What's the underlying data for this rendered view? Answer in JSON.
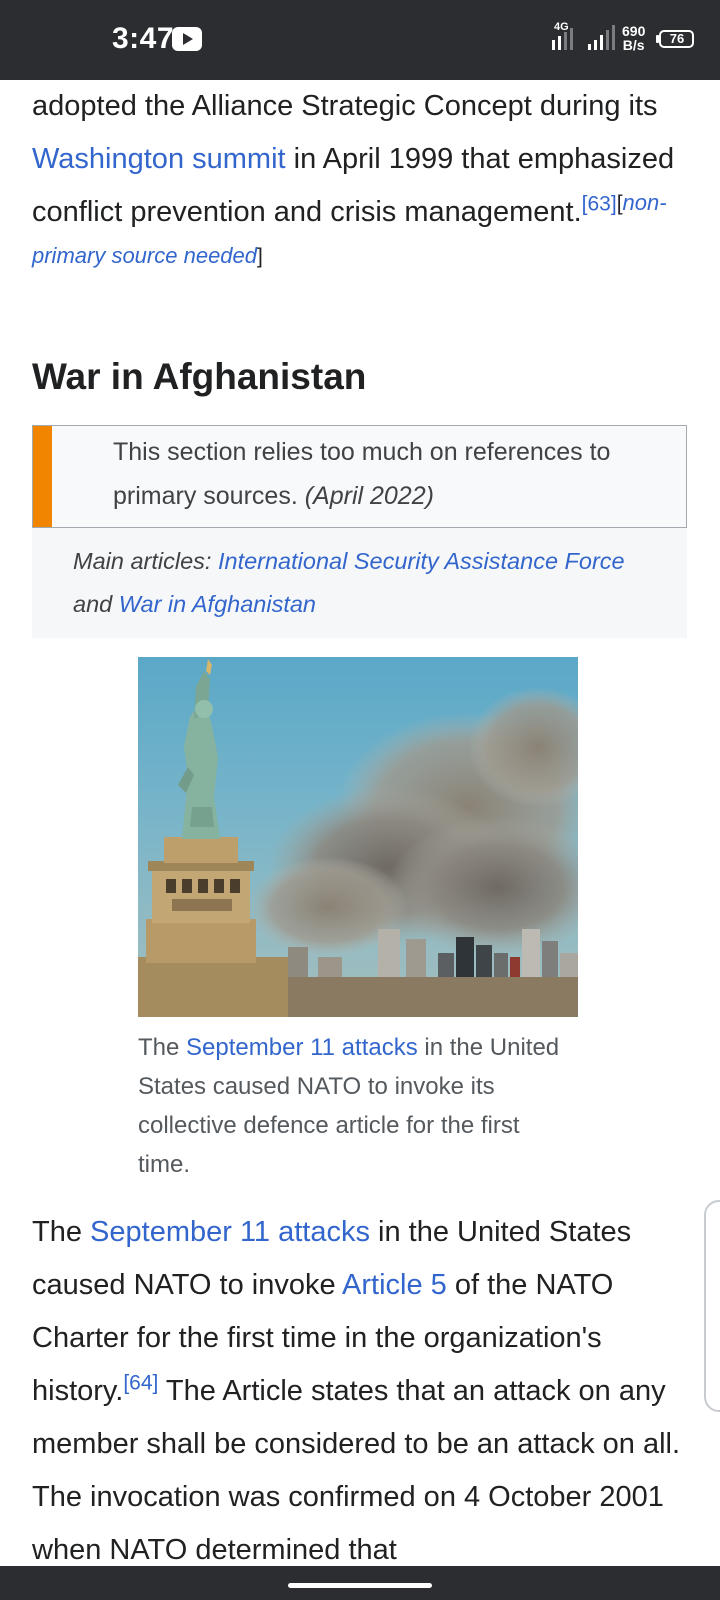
{
  "status_bar": {
    "time": "3:47",
    "network_type": "4G",
    "data_speed_value": "690",
    "data_speed_unit": "B/s",
    "battery_level": "76",
    "icons": [
      "youtube-notification-icon",
      "signal-4g-icon",
      "signal-bars-icon",
      "battery-icon"
    ]
  },
  "intro_paragraph": {
    "text_1": "adopted the Alliance Strategic Concept during its ",
    "link_washington": "Washington summit",
    "text_2": " in April 1999 that emphasized conflict prevention and crisis management.",
    "ref_63": "[63]",
    "ref_needed_open": "[",
    "ref_needed_text": "non-primary source needed",
    "ref_needed_close": "]"
  },
  "section": {
    "heading": "War in Afghanistan",
    "notice_text": "This section relies too much on references to primary sources.",
    "notice_date": "(April 2022)",
    "colors": {
      "notice_bar": "#f28500",
      "link": "#3366cc"
    }
  },
  "hatnote": {
    "prefix": "Main articles: ",
    "link_isaf": "International Security Assistance Force",
    "conjunction": " and ",
    "link_war": "War in Afghanistan"
  },
  "figure": {
    "caption_prefix": "The ",
    "caption_link": "September 11 attacks",
    "caption_suffix": " in the United States caused NATO to invoke its collective defence article for the first time."
  },
  "main_paragraph": {
    "text_1": "The ",
    "link_sept11": "September 11 attacks",
    "text_2": " in the United States caused NATO to invoke ",
    "link_article5": "Article 5",
    "text_3": " of the NATO Charter for the first time in the organization's history.",
    "ref_64": "[64]",
    "text_4": " The Article states that an attack on any member shall be considered to be an attack on all. The invocation was confirmed on 4 October 2001 when NATO determined that"
  }
}
